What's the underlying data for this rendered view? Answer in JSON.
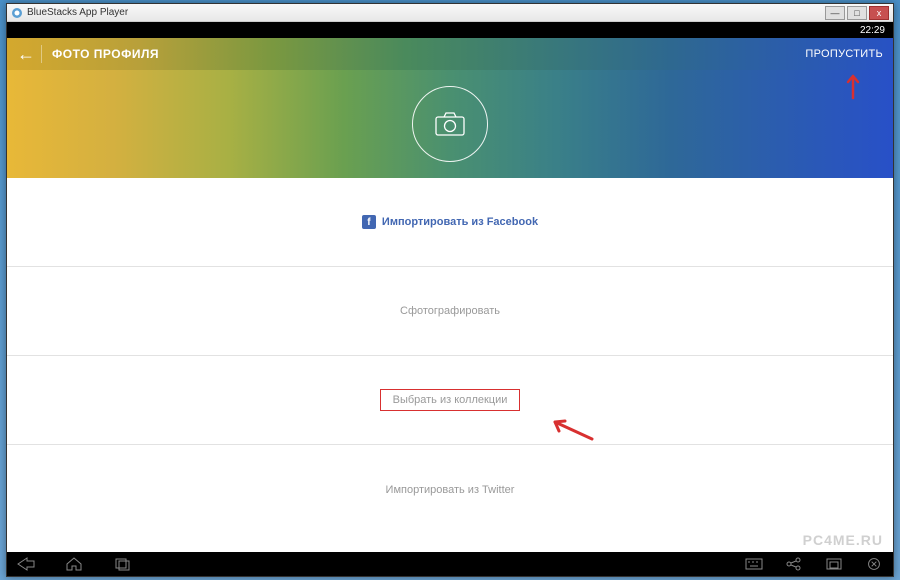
{
  "window": {
    "title": "BlueStacks App Player"
  },
  "statusbar": {
    "time": "22:29"
  },
  "header": {
    "title": "ФОТО ПРОФИЛЯ",
    "skip": "ПРОПУСТИТЬ"
  },
  "options": {
    "facebook": "Импортировать из Facebook",
    "photo": "Сфотографировать",
    "gallery": "Выбрать из коллекции",
    "twitter": "Импортировать из Twitter"
  },
  "watermark": "PC4ME.RU",
  "fb_icon_letter": "f"
}
